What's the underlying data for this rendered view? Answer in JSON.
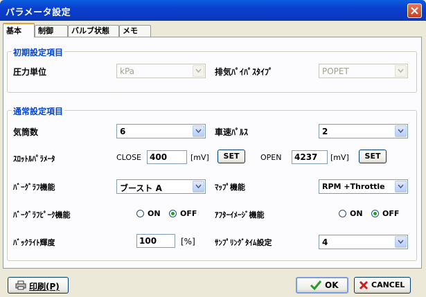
{
  "window": {
    "title": "パラメータ設定"
  },
  "tabs": [
    {
      "label": "基本"
    },
    {
      "label": "制御"
    },
    {
      "label": "バルブ状態"
    },
    {
      "label": "メモ"
    }
  ],
  "initial": {
    "legend": "初期設定項目",
    "pressure_unit": {
      "label": "圧力単位",
      "value": "kPa"
    },
    "exhaust_pipe": {
      "label": "排気ﾊﾟｲﾊﾟｽﾀｲﾌﾟ",
      "value": "POPET"
    }
  },
  "normal": {
    "legend": "通常設定項目",
    "cylinders": {
      "label": "気筒数",
      "value": "6"
    },
    "speed_pulse": {
      "label": "車速ﾊﾟﾙｽ",
      "value": "2"
    },
    "throttle": {
      "label": "ｽﾛｯﾄﾙﾊﾟﾗﾒｰﾀ",
      "close_label": "CLOSE",
      "close_value": "400",
      "close_unit": "[mV]",
      "close_set": "SET",
      "open_label": "OPEN",
      "open_value": "4237",
      "open_unit": "[mV]",
      "open_set": "SET"
    },
    "bargraph": {
      "label": "ﾊﾞｰｸﾞﾗﾌ機能",
      "value": "ブースト A"
    },
    "map": {
      "label": "ﾏｯﾌﾟ機能",
      "value": "RPM +Throttle"
    },
    "bargraph_peak": {
      "label": "ﾊﾞｰｸﾞﾗﾌﾋﾟｰｸ機能",
      "on": "ON",
      "off": "OFF"
    },
    "afterimage": {
      "label": "ｱﾌﾀｰｲﾒｰｼﾞ機能",
      "on": "ON",
      "off": "OFF"
    },
    "backlight": {
      "label": "ﾊﾞｯｸﾗｲﾄ輝度",
      "value": "100",
      "unit": "[%]"
    },
    "sampling": {
      "label": "ｻﾝﾌﾟﾘﾝｸﾞﾀｲﾑ設定",
      "value": "4"
    }
  },
  "footer": {
    "print_label": "印刷(P)",
    "ok_label": "OK",
    "cancel_label": "CANCEL"
  },
  "icons": {
    "print": "printer-icon",
    "ok": "checkmark-icon",
    "cancel": "x-icon",
    "close": "close-icon"
  },
  "colors": {
    "titlebar": "#0a50d8",
    "legend": "#0046d5",
    "ok_check": "#2a9a2a",
    "cancel_x": "#c81e1e"
  }
}
